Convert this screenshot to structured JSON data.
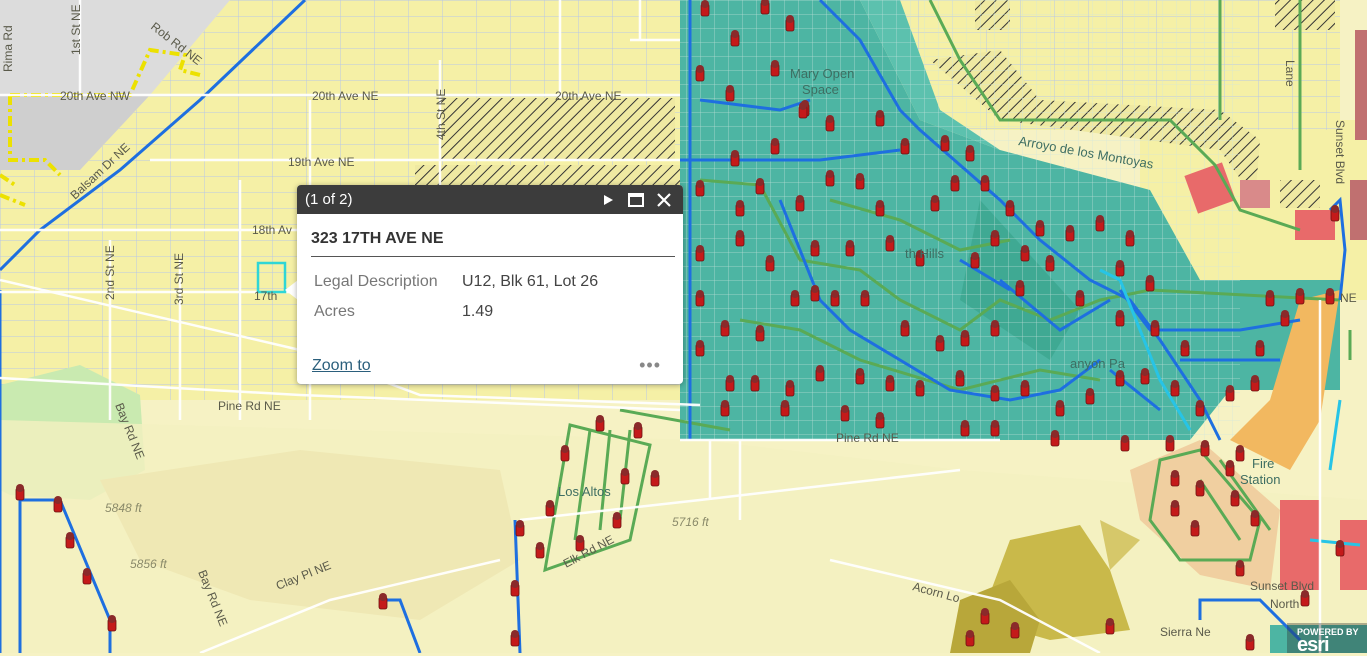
{
  "popup": {
    "counter": "(1 of 2)",
    "title": "323 17TH AVE NE",
    "fields": [
      {
        "key": "Legal Description",
        "value": "U12, Blk 61, Lot 26"
      },
      {
        "key": "Acres",
        "value": "1.49"
      }
    ],
    "zoom_label": "Zoom to",
    "more_label": "•••"
  },
  "map": {
    "streets": {
      "rima": "Rima Rd",
      "st1": "1st St NE",
      "rob": "Rob Rd NE",
      "ave20nw": "20th Ave NW",
      "ave20ne_a": "20th Ave NE",
      "ave20ne_b": "20th Ave NE",
      "st4": "4th St NE",
      "ave19": "19th Ave NE",
      "ave18": "18th Av",
      "ave17": "17th",
      "st2": "2nd St NE",
      "st3": "3rd St NE",
      "pine_a": "Pine Rd NE",
      "pine_b": "Pine Rd NE",
      "bay": "Bay Rd NE",
      "bay2": "Bay Rd NE",
      "clay": "Clay Pl NE",
      "elk": "Elk Rd NE",
      "acorn": "Acorn Lo",
      "sunset": "Sunset Blvd",
      "sunset2": "Sunset Blvd",
      "ne": "NE",
      "north": "North",
      "sierra": "Sierra Ne",
      "lane": "Lane",
      "bal": "Balsam Dr NE"
    },
    "areas": {
      "openspace": "Mary Open Space",
      "openspace1": "Mary Open",
      "openspace2": "Space",
      "arroyo": "Arroyo de los Montoyas",
      "north_hills": "th Hills",
      "canyon": "anyon Pa",
      "los_altos": "Los Altos",
      "station": "Station",
      "fire": "Fire"
    },
    "elevations": {
      "e1": "5848 ft",
      "e2": "5856 ft",
      "e3": "5716 ft"
    },
    "attribution": {
      "powered": "POWERED BY",
      "brand": "esri"
    },
    "colors": {
      "base": "#f6f2c4",
      "residential": "#f5f0a6",
      "open_space": "#4db5a3",
      "pipe": "#1e6fe0",
      "trail": "#5aaa55",
      "hydrant": "#c41a1a",
      "commercial": "#f2b860",
      "industrial": "#e86a6a",
      "selection": "#2fd6d6"
    }
  }
}
